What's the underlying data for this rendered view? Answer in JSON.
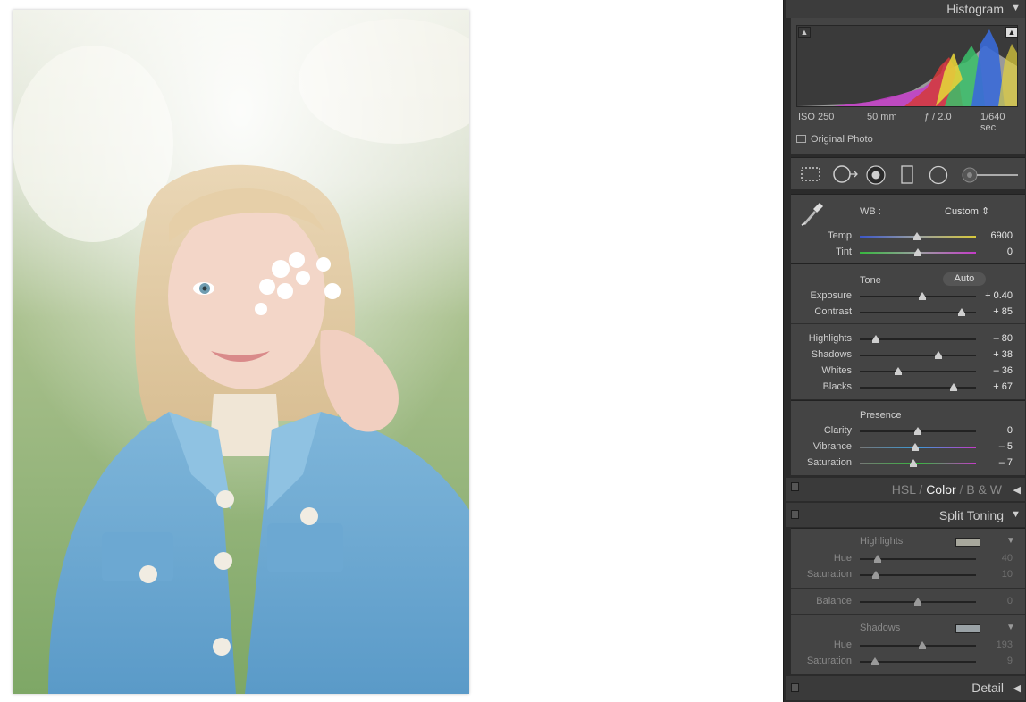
{
  "histogram": {
    "title": "Histogram",
    "iso": "ISO 250",
    "focal": "50 mm",
    "aperture": "ƒ / 2.0",
    "shutter": "1/640 sec",
    "original_photo_label": "Original Photo"
  },
  "basic": {
    "wb_label": "WB :",
    "wb_value": "Custom",
    "sliders_wb": [
      {
        "label": "Temp",
        "value": "6900",
        "position": 0.49
      },
      {
        "label": "Tint",
        "value": "0",
        "position": 0.5
      }
    ],
    "tone_label": "Tone",
    "auto_label": "Auto",
    "sliders_tone": [
      {
        "label": "Exposure",
        "value": "+ 0.40",
        "position": 0.54
      },
      {
        "label": "Contrast",
        "value": "+ 85",
        "position": 0.88
      }
    ],
    "sliders_tone2": [
      {
        "label": "Highlights",
        "value": "– 80",
        "position": 0.14
      },
      {
        "label": "Shadows",
        "value": "+ 38",
        "position": 0.68
      },
      {
        "label": "Whites",
        "value": "– 36",
        "position": 0.33
      },
      {
        "label": "Blacks",
        "value": "+ 67",
        "position": 0.81
      }
    ],
    "presence_label": "Presence",
    "sliders_presence": [
      {
        "label": "Clarity",
        "value": "0",
        "position": 0.5
      },
      {
        "label": "Vibrance",
        "value": "– 5",
        "position": 0.48
      },
      {
        "label": "Saturation",
        "value": "– 7",
        "position": 0.46
      }
    ]
  },
  "hsl": {
    "hsl": "HSL",
    "sep1": "/",
    "color": "Color",
    "sep2": "/",
    "bw": "B & W"
  },
  "split": {
    "title": "Split Toning",
    "highlights_label": "Highlights",
    "highlights_color": "#a7a79c",
    "highlights_sliders": [
      {
        "label": "Hue",
        "value": "40",
        "position": 0.15
      },
      {
        "label": "Saturation",
        "value": "10",
        "position": 0.14
      }
    ],
    "balance": {
      "label": "Balance",
      "value": "0",
      "position": 0.5
    },
    "shadows_label": "Shadows",
    "shadows_color": "#9aa2a6",
    "shadows_sliders": [
      {
        "label": "Hue",
        "value": "193",
        "position": 0.54
      },
      {
        "label": "Saturation",
        "value": "9",
        "position": 0.13
      }
    ]
  },
  "detail": {
    "title": "Detail"
  }
}
